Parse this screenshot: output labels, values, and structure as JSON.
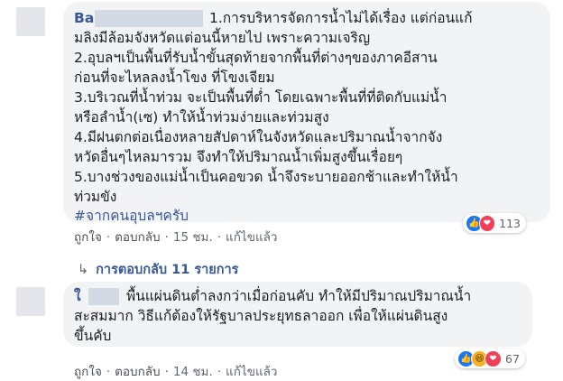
{
  "comment1": {
    "author": "Ba",
    "lines": [
      "1.การบริหารจัดการน้ำไม่ได้เรื่อง แต่ก่อนแก้",
      "มลิงมีล้อมจังหวัดแต่อนนี้หายไป เพราะความเจริญ",
      "2.อุบลฯเป็นพื้นที่รับน้ำขั้นสุดท้ายจากพื้นที่ต่างๆของภาคอีสาน",
      "ก่อนที่จะไหลลงน้ำโขง ที่โขงเจียม",
      "3.บริเวณที่น้ำท่วม จะเป็นพื้นที่ต่ำ โดยเฉพาะพื้นที่ที่ติดกับแม่น้ำ",
      "หรือลำน้ำ(เซ) ทำให้น้ำท่วมง่ายและท่วมสูง",
      "4.มีฝนตกต่อเนื่องหลายสัปดาห์ในจังหวัดและปริมาณน้ำจากจัง",
      "หวัดอื่นๆไหลมารวม จึงทำให้ปริมาณน้ำเพิ่มสูงขึ้นเรื่อยๆ",
      "5.บางช่วงของแม่น้ำเป็นคอขวด น้ำจึงระบายออกช้าและทำให้น้ำ",
      "ท่วมขัง"
    ],
    "hashtag": "#จากคนอุบลฯครับ",
    "reaction_count": "113",
    "actions": {
      "like": "ถูกใจ",
      "reply": "ตอบกลับ",
      "time": "15 ชม.",
      "edited": "แก้ไขแล้ว"
    }
  },
  "replies_link": {
    "arrow": "↳",
    "label": "การตอบกลับ 11 รายการ"
  },
  "comment2": {
    "author": "ใ",
    "lines": [
      "พื้นแผ่นดินต่ำลงกว่าเมื่อก่อนคับ ทำให้มีปริมาณปริมาณน้ำ",
      "สะสมมาก วิธีแก้ต้องให้รัฐบาลประยุทธลาออก เพื่อให้แผ่นดินสูง",
      "ขึ้นคับ"
    ],
    "reaction_count": "67",
    "actions": {
      "like": "ถูกใจ",
      "reply": "ตอบกลับ",
      "time": "14 ชม.",
      "edited": "แก้ไขแล้ว"
    }
  },
  "colors": {
    "link": "#385898",
    "bubble": "#f2f3f5",
    "like": "#1877f2",
    "love": "#f33e58",
    "haha": "#f7b125"
  }
}
